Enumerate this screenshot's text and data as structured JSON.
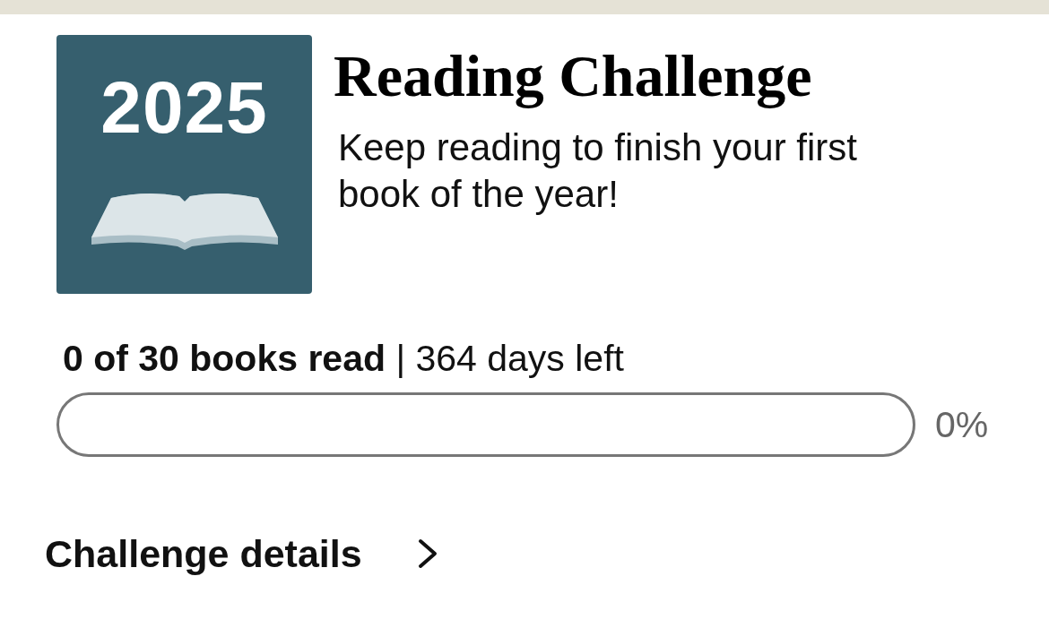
{
  "badge": {
    "year": "2025"
  },
  "title": "Reading Challenge",
  "subtitle": "Keep reading to finish your first book of the year!",
  "progress": {
    "summary": "**0 of 30 books read** | 364 days left",
    "level": 0,
    "percent": "0%"
  },
  "details_link": {
    "label": "Challenge details"
  }
}
